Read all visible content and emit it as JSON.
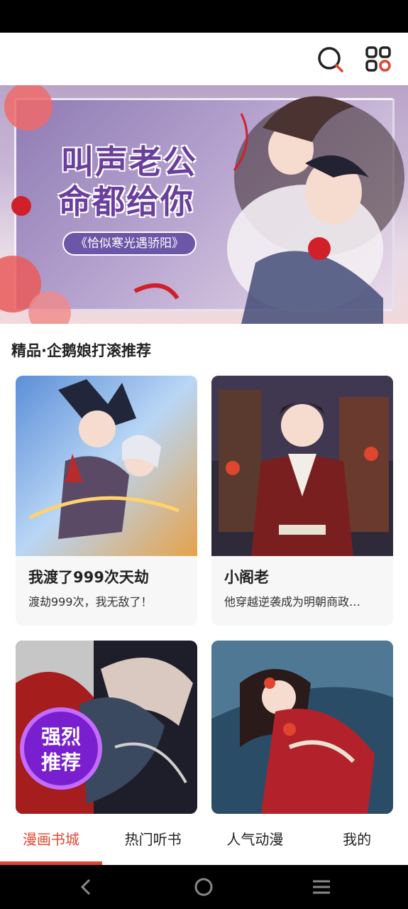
{
  "top_bar": {
    "search_icon": "search-icon",
    "apps_icon": "apps-grid-icon",
    "accent": "#e0452f"
  },
  "banner": {
    "title_line1": "叫声老公",
    "title_line2": "命都给你",
    "subtitle": "《恰似寒光遇骄阳》"
  },
  "section": {
    "title": "精品·企鹅娘打滚推荐"
  },
  "cards": [
    {
      "title": "我渡了999次天劫",
      "desc": "渡劫999次，我无敌了！"
    },
    {
      "title": "小阁老",
      "desc": "他穿越逆袭成为明朝商政…"
    },
    {
      "badge": "强烈推荐",
      "badge_line1": "强烈",
      "badge_line2": "推荐"
    },
    {}
  ],
  "tabs": [
    {
      "label": "漫画书城",
      "active": true
    },
    {
      "label": "热门听书",
      "active": false
    },
    {
      "label": "人气动漫",
      "active": false
    },
    {
      "label": "我的",
      "active": false
    }
  ],
  "nav": {
    "back_icon": "back-icon",
    "home_icon": "home-icon",
    "menu_icon": "menu-icon"
  }
}
